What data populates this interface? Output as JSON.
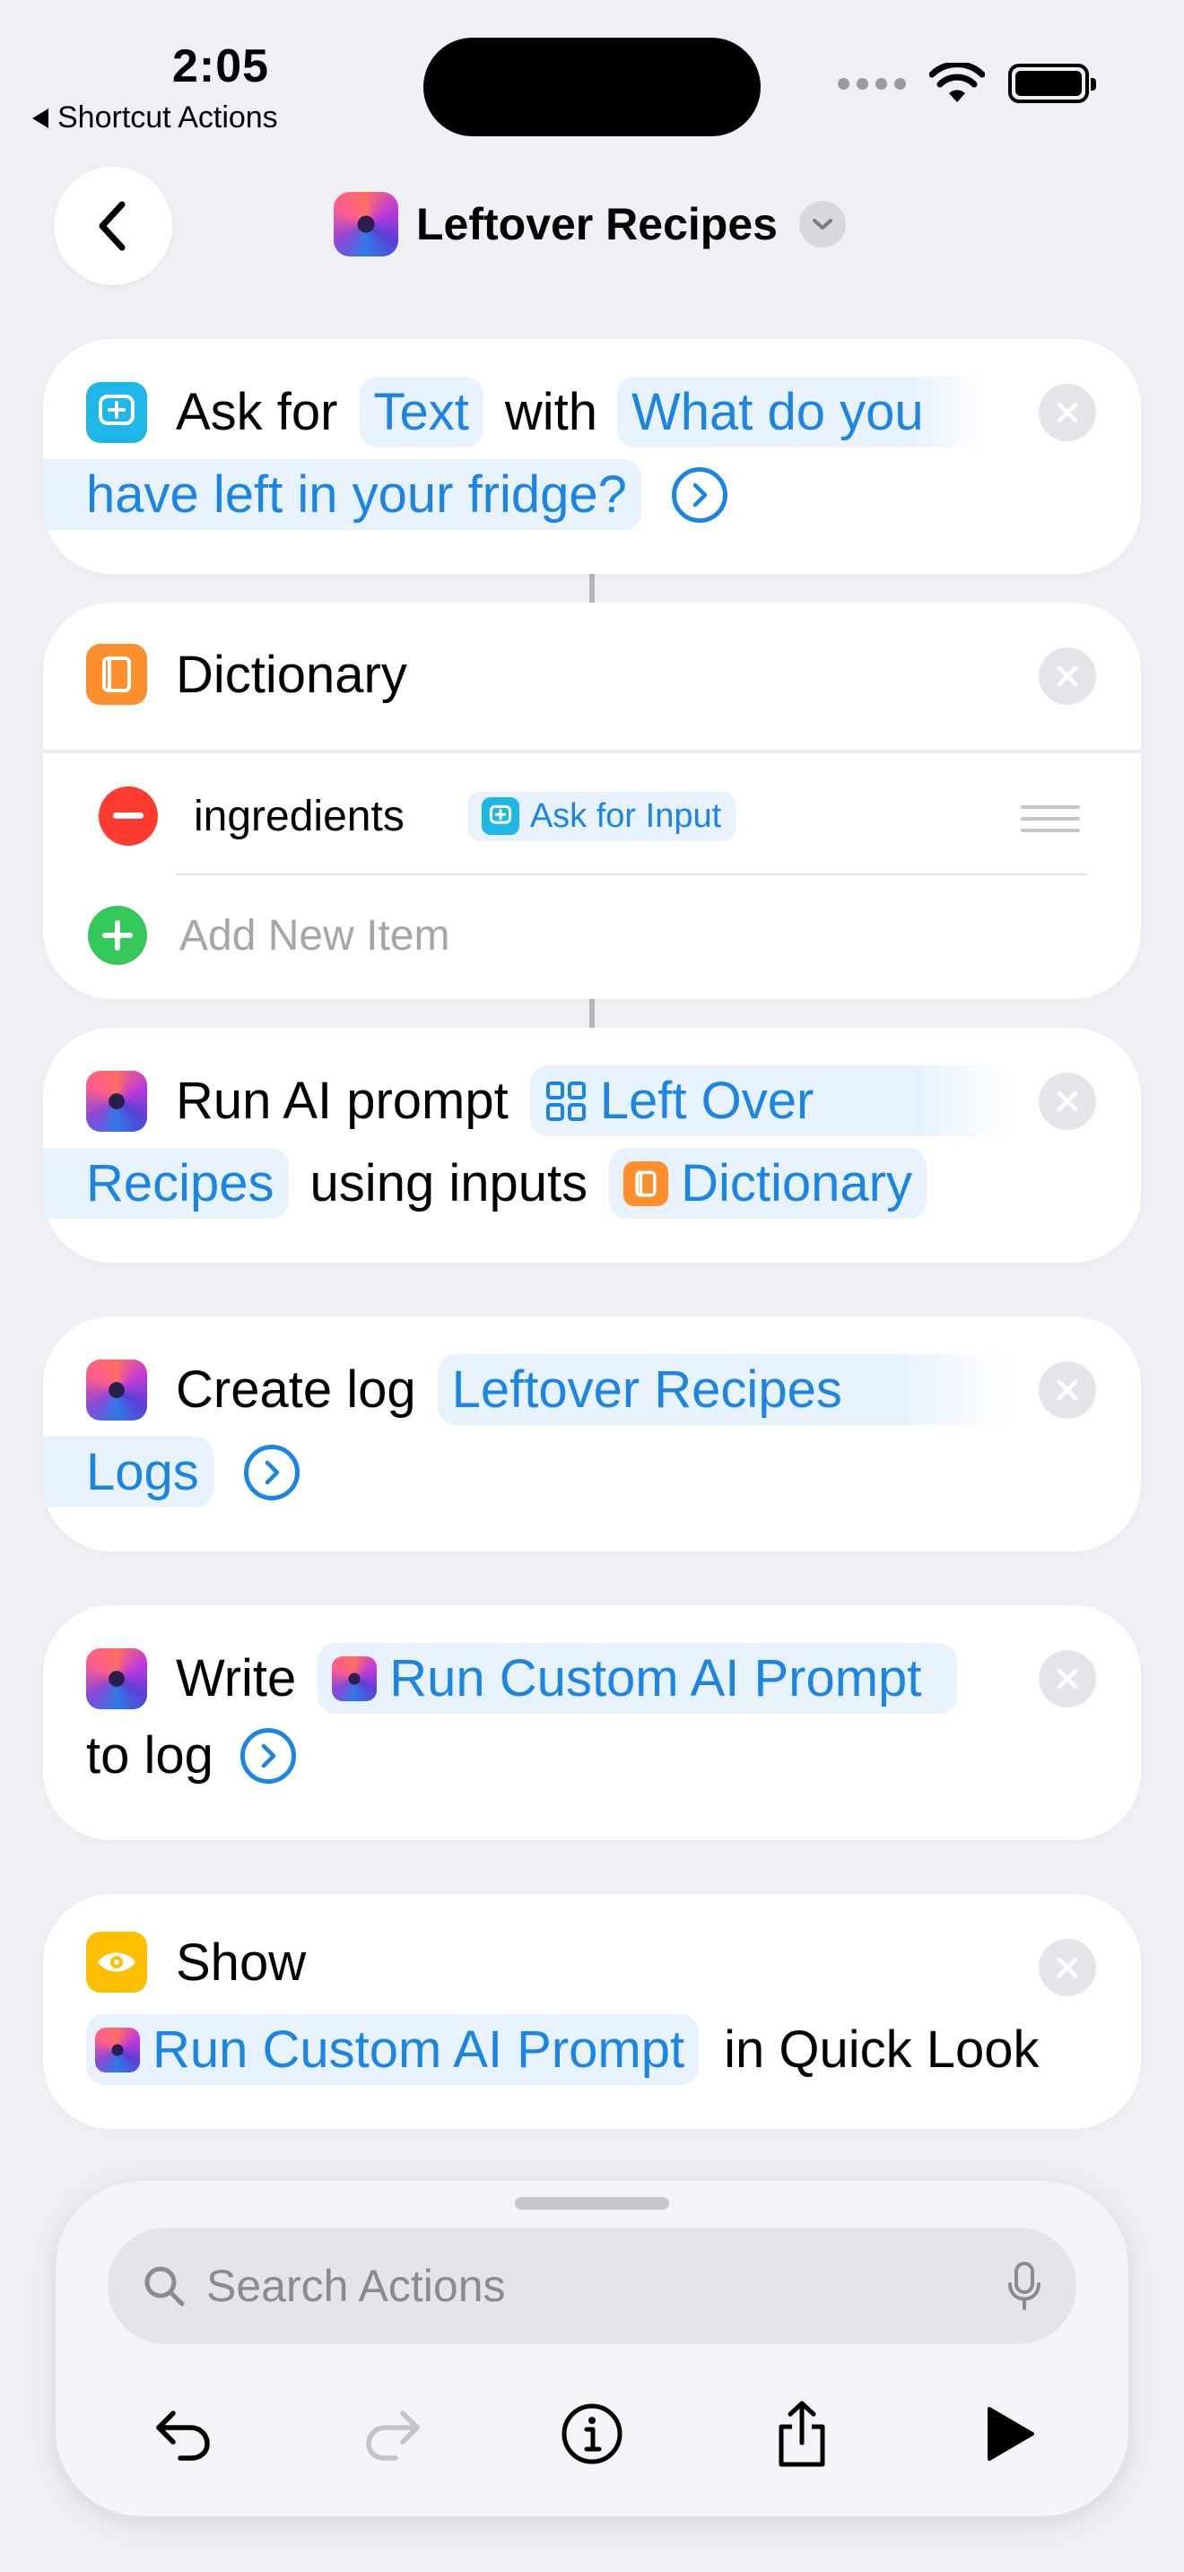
{
  "status": {
    "time": "2:05",
    "back_label": "Shortcut Actions"
  },
  "nav": {
    "title": "Leftover Recipes"
  },
  "actions": {
    "ask": {
      "verb": "Ask for",
      "type": "Text",
      "with": "with",
      "prompt_line1": "What do you",
      "prompt_line2": "have left in your fridge?"
    },
    "dictionary": {
      "title": "Dictionary",
      "key": "ingredients",
      "value": "Ask for Input",
      "add_placeholder": "Add New Item"
    },
    "run_ai": {
      "verb": "Run AI prompt",
      "prompt_line1": "Left Over",
      "prompt_line2": "Recipes",
      "using": "using inputs",
      "input": "Dictionary"
    },
    "create_log": {
      "verb": "Create log",
      "name_line1": "Leftover Recipes",
      "name_line2": "Logs"
    },
    "write": {
      "verb": "Write",
      "value": "Run Custom AI Prompt",
      "to_log": "to log"
    },
    "show": {
      "verb": "Show",
      "value": "Run Custom AI Prompt",
      "suffix": "in Quick Look"
    }
  },
  "search": {
    "placeholder": "Search Actions"
  },
  "colors": {
    "accent": "#1b85e6",
    "pill_bg": "#e7f2fd",
    "ask_icon": "#1fb6e8",
    "dict_icon": "#ff8f2e",
    "show_icon": "#ffbf00",
    "remove": "#ff3b30",
    "add": "#34c759"
  }
}
